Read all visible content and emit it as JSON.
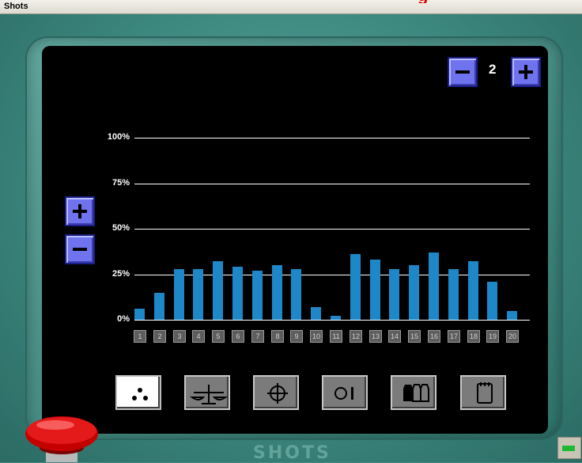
{
  "window": {
    "title": "Shots",
    "title_fragment": "g"
  },
  "level_control": {
    "value": "2"
  },
  "colors": {
    "bar": "#1e87c8",
    "button": "#6f74ee",
    "screen": "#000000"
  },
  "chart_data": {
    "type": "bar",
    "categories": [
      "1",
      "2",
      "3",
      "4",
      "5",
      "6",
      "7",
      "8",
      "9",
      "10",
      "11",
      "12",
      "13",
      "14",
      "15",
      "16",
      "17",
      "18",
      "19",
      "20"
    ],
    "values": [
      6,
      15,
      28,
      28,
      32,
      29,
      27,
      30,
      28,
      7,
      2,
      36,
      33,
      28,
      30,
      37,
      28,
      32,
      21,
      5
    ],
    "yticks": [
      "0%",
      "25%",
      "50%",
      "75%",
      "100%"
    ],
    "ylim": [
      0,
      100
    ],
    "grid": true
  },
  "toolbar": {
    "tools": [
      {
        "icon": "dots-icon",
        "active": true
      },
      {
        "icon": "scale-icon",
        "active": false
      },
      {
        "icon": "crosshair-icon",
        "active": false
      },
      {
        "icon": "toggle-icon",
        "active": false
      },
      {
        "icon": "bottles-icon",
        "active": false
      },
      {
        "icon": "notepad-icon",
        "active": false
      }
    ]
  },
  "brand": {
    "logo_text": "SHOTS"
  },
  "status": {
    "indicator_color": "#1fb832"
  }
}
